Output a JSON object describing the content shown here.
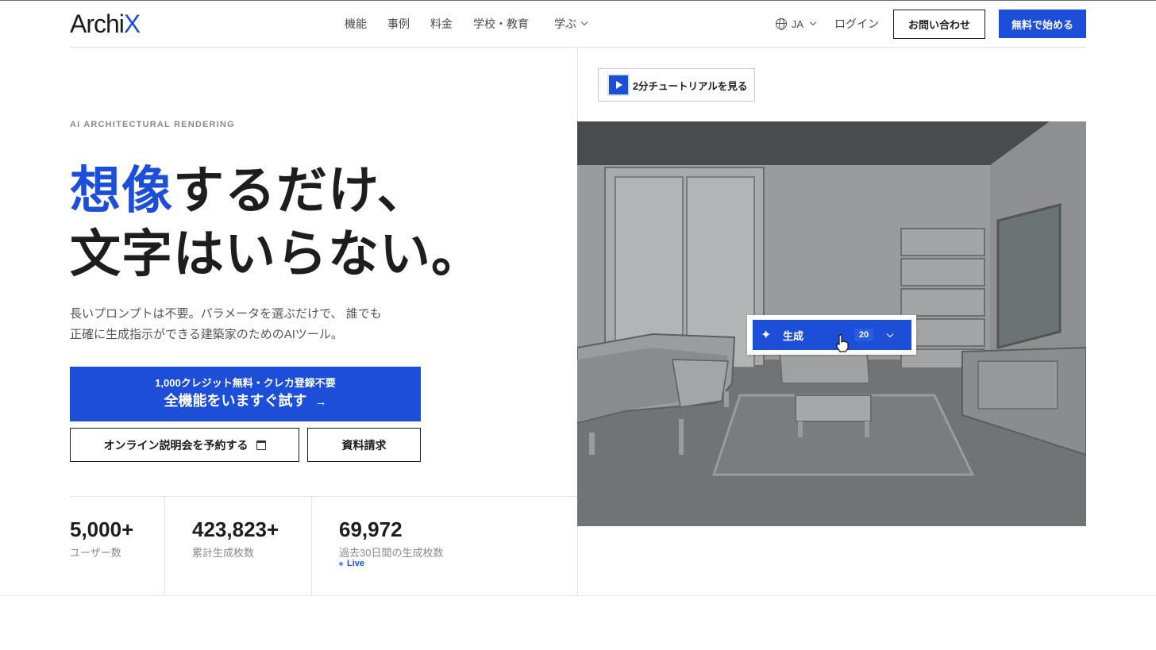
{
  "brand": {
    "logo_main": "Archi",
    "logo_accent": "X",
    "accent_color": "#1d4ed8"
  },
  "nav": {
    "items": [
      "機能",
      "事例",
      "料金",
      "学校・教育"
    ],
    "learn_label": "学ぶ",
    "language": "JA",
    "login": "ログイン",
    "contact": "お問い合わせ",
    "start": "無料で始める"
  },
  "hero": {
    "eyebrow": "AI ARCHITECTURAL RENDERING",
    "headline_highlight": "想像",
    "headline_rest_line1": "するだけ、",
    "headline_line2": "文字はいらない。",
    "description_line1": "長いプロンプトは不要。パラメータを選ぶだけで、 誰でも",
    "description_line2": "正確に生成指示ができる建築家のためのAIツール。",
    "cta_small": "1,000クレジット無料・クレカ登録不要",
    "cta_big": "全機能をいますぐ試す",
    "seminar_button": "オンライン説明会を予約する",
    "docs_button": "資料請求"
  },
  "stats": [
    {
      "value": "5,000+",
      "label": "ユーザー数"
    },
    {
      "value": "423,823+",
      "label": "累計生成枚数"
    },
    {
      "value": "69,972",
      "label": "過去30日間の生成枚数",
      "badge": "Live"
    }
  ],
  "demo": {
    "tutorial_label": "2分チュートリアルを見る",
    "generate_label": "生成",
    "generate_count": "20",
    "icons": [
      "play-icon",
      "sparkle-icon",
      "chevron-down-icon",
      "hand-cursor-icon",
      "globe-icon",
      "calendar-icon",
      "arrow-right-icon"
    ]
  }
}
